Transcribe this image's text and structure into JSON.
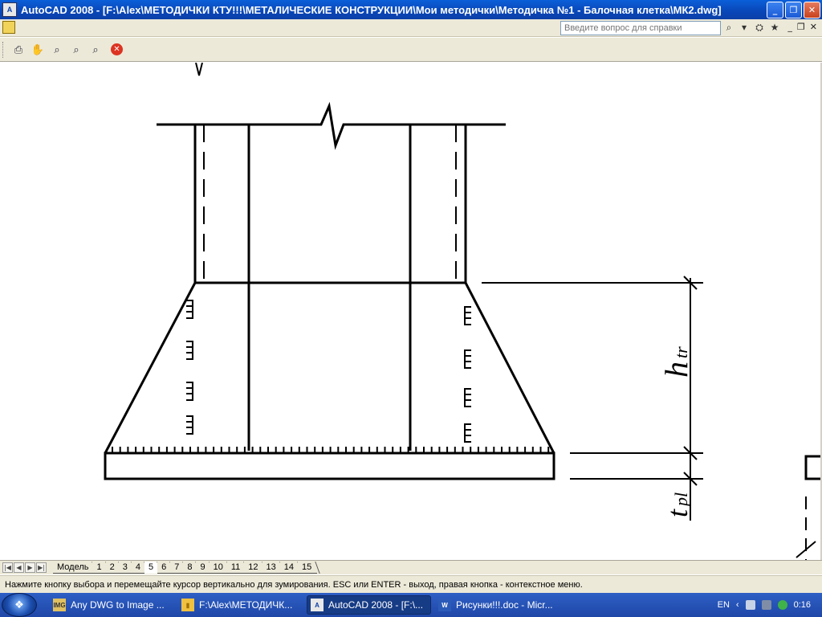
{
  "window": {
    "icon_text": "A",
    "title": "AutoCAD 2008 - [F:\\Alex\\МЕТОДИЧКИ КТУ!!!\\МЕТАЛИЧЕСКИЕ КОНСТРУКЦИИ\\Мои методички\\Методичка №1 - Балочная клетка\\МК2.dwg]",
    "buttons": {
      "minimize": "_",
      "maximize": "❐",
      "close": "✕"
    }
  },
  "help": {
    "placeholder": "Введите вопрос для справки",
    "search_icon": "search-icon",
    "tools": [
      "⌕",
      "▾",
      "⛭",
      "★"
    ],
    "mdi": [
      "_",
      "❐",
      "✕"
    ]
  },
  "toolbar": {
    "icons": [
      "print-icon",
      "pan-icon",
      "zoom-realtime-icon",
      "zoom-window-icon",
      "zoom-previous-icon",
      "close-icon"
    ],
    "glyphs": [
      "⎙",
      "✋",
      "⌕",
      "⌕",
      "⌕",
      "✕"
    ]
  },
  "drawing": {
    "label_h": "h",
    "label_h_sub": "tr",
    "label_t": "t",
    "label_t_sub": "pl"
  },
  "layout_tabs": {
    "nav": [
      "|◀",
      "◀",
      "▶",
      "▶|"
    ],
    "tabs": [
      "Модель",
      "1",
      "2",
      "3",
      "4",
      "5",
      "6",
      "7",
      "8",
      "9",
      "10",
      "11",
      "12",
      "13",
      "14",
      "15"
    ],
    "active": "5"
  },
  "status": {
    "text": "Нажмите кнопку выбора и перемещайте курсор вертикально для зумирования. ESC или ENTER - выход, правая кнопка - контекстное меню."
  },
  "taskbar": {
    "start_glyph": "❖",
    "tasks": [
      {
        "label": "Any DWG to Image ...",
        "icon": "IMG",
        "active": false
      },
      {
        "label": "F:\\Alex\\МЕТОДИЧК...",
        "icon": "▮",
        "active": false
      },
      {
        "label": "AutoCAD 2008 - [F:\\...",
        "icon": "A",
        "active": true
      },
      {
        "label": "Рисунки!!!.doc - Micr...",
        "icon": "W",
        "active": false
      }
    ],
    "lang": "EN",
    "clock": "0:16"
  }
}
